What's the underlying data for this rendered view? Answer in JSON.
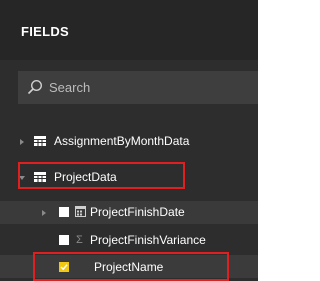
{
  "panel": {
    "title": "FIELDS"
  },
  "search": {
    "placeholder": "Search",
    "icon": "search-icon"
  },
  "tables": [
    {
      "name": "AssignmentByMonthData",
      "expanded": false,
      "icon": "table-icon"
    },
    {
      "name": "ProjectData",
      "expanded": true,
      "icon": "table-icon",
      "highlighted": true,
      "fields": [
        {
          "name": "ProjectFinishDate",
          "checked": false,
          "expandable": true,
          "icon": "calendar-hierarchy-icon"
        },
        {
          "name": "ProjectFinishVariance",
          "checked": false,
          "expandable": false,
          "icon": "sigma-icon"
        },
        {
          "name": "ProjectName",
          "checked": true,
          "expandable": false,
          "icon": "",
          "highlighted": true
        }
      ]
    }
  ],
  "colors": {
    "panel_background": "#2d2d2d",
    "header_background": "#262626",
    "search_background": "#3e3e3e",
    "checked_checkbox": "#f2c811",
    "highlight_border": "#e02020"
  }
}
